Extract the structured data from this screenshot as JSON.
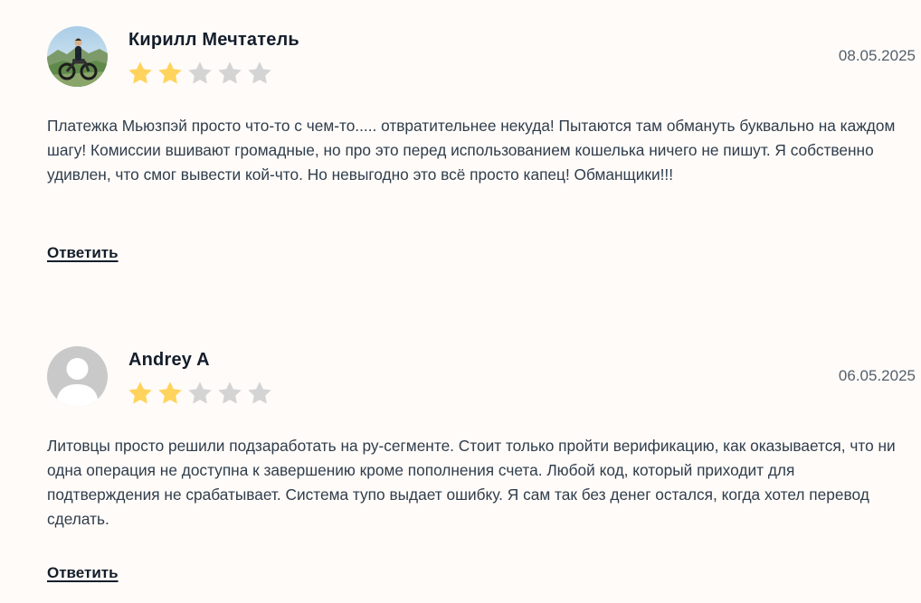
{
  "reviews": [
    {
      "author": "Кирилл Мечтатель",
      "avatar_icon": "user-photo-motorcycle",
      "rating": 2,
      "rating_max": 5,
      "date": "08.05.2025",
      "text": "Платежка Мьюзпэй просто что-то с чем-то..... отвратительнее некуда! Пытаются там обмануть буквально на каждом шагу! Комиссии вшивают громадные, но про это перед использованием кошелька ничего не пишут. Я собственно удивлен, что смог вывести кой-что. Но невыгодно это всё просто капец! Обманщики!!!",
      "reply_label": "Ответить"
    },
    {
      "author": "Andrey A",
      "avatar_icon": "default-user-icon",
      "rating": 2,
      "rating_max": 5,
      "date": "06.05.2025",
      "text": "Литовцы просто решили подзаработать на ру-сегменте. Стоит только пройти верификацию, как оказывается, что ни одна операция не доступна к завершению кроме пополнения счета. Любой код, который приходит для подтверждения не срабатывает. Система тупо выдает ошибку. Я сам так без денег остался, когда хотел перевод сделать.",
      "reply_label": "Ответить"
    }
  ],
  "colors": {
    "background": "#fffbf8",
    "star_filled": "#ffd35c",
    "star_empty": "#d4d4d4",
    "heading": "#141e2c",
    "text": "#2f3d4c"
  }
}
